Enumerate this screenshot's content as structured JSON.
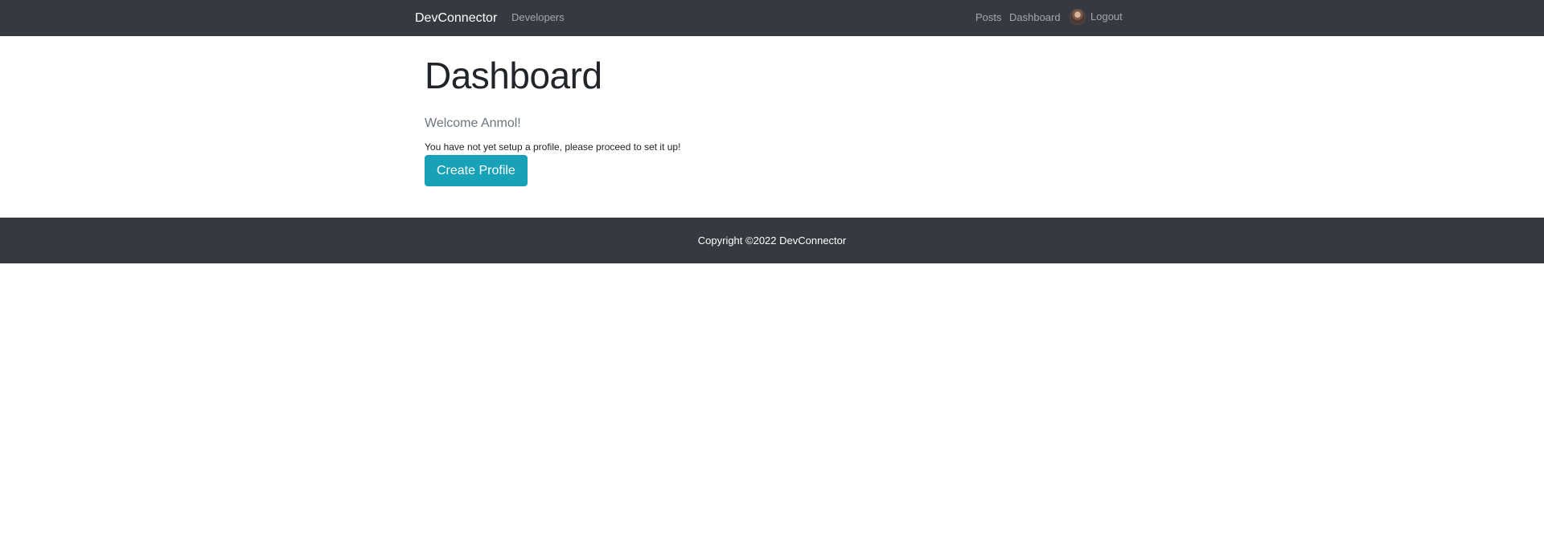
{
  "navbar": {
    "brand": "DevConnector",
    "links_left": [
      {
        "label": "Developers"
      }
    ],
    "links_right": [
      {
        "label": "Posts"
      },
      {
        "label": "Dashboard"
      },
      {
        "label": "Logout",
        "icon": "user-avatar"
      }
    ]
  },
  "main": {
    "title": "Dashboard",
    "welcome": "Welcome Anmol!",
    "notice": "You have not yet setup a profile, please proceed to set it up!",
    "create_button_label": "Create Profile"
  },
  "footer": {
    "text": "Copyright ©2022 DevConnector"
  },
  "colors": {
    "navbar_bg": "#343a40",
    "accent_button": "#17a2b8",
    "text_dark": "#212529",
    "text_muted": "#6c757d"
  }
}
